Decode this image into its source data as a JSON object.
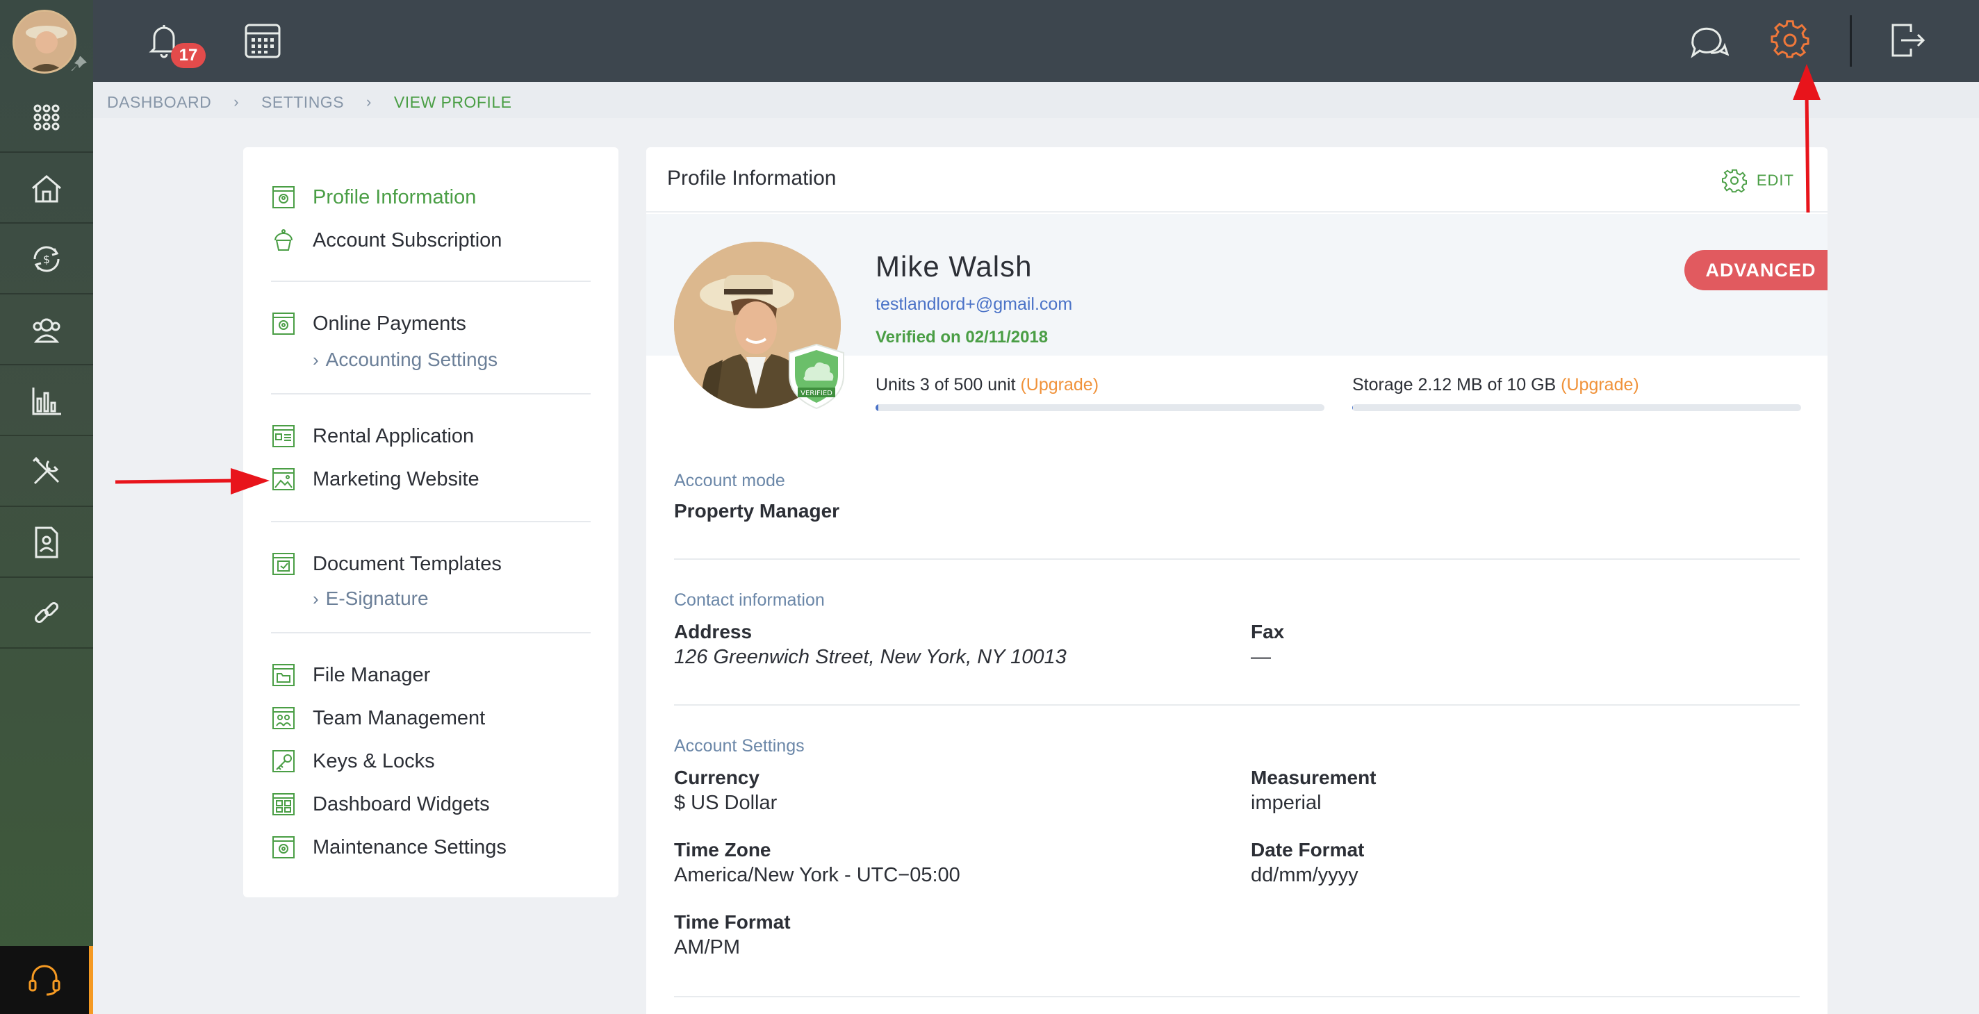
{
  "topbar": {
    "notification_count": "17"
  },
  "breadcrumb": {
    "items": [
      "DASHBOARD",
      "SETTINGS",
      "VIEW PROFILE"
    ]
  },
  "settings_menu": {
    "profile_information": "Profile Information",
    "account_subscription": "Account Subscription",
    "online_payments": "Online Payments",
    "accounting_settings": "Accounting Settings",
    "rental_application": "Rental Application",
    "marketing_website": "Marketing Website",
    "document_templates": "Document Templates",
    "e_signature": "E-Signature",
    "file_manager": "File Manager",
    "team_management": "Team Management",
    "keys_locks": "Keys & Locks",
    "dashboard_widgets": "Dashboard Widgets",
    "maintenance_settings": "Maintenance Settings"
  },
  "profile": {
    "card_title": "Profile Information",
    "edit_label": "EDIT",
    "name": "Mike Walsh",
    "email": "testlandlord+@gmail.com",
    "verified_text": "Verified on 02/11/2018",
    "verified_badge_text": "VERIFIED",
    "plan_badge": "ADVANCED",
    "units_text": "Units 3 of 500 unit ",
    "units_upgrade": "(Upgrade)",
    "units_fraction": 0.006,
    "storage_text": "Storage 2.12 MB of 10 GB ",
    "storage_upgrade": "(Upgrade)",
    "storage_fraction": 0.0002
  },
  "account_mode": {
    "section_label": "Account mode",
    "value": "Property Manager"
  },
  "contact": {
    "section_label": "Contact information",
    "address_label": "Address",
    "address_value": "126 Greenwich Street, New York, NY 10013",
    "fax_label": "Fax",
    "fax_value": "—"
  },
  "account_settings": {
    "section_label": "Account Settings",
    "currency_label": "Currency",
    "currency_value": "$ US Dollar",
    "measurement_label": "Measurement",
    "measurement_value": "imperial",
    "timezone_label": "Time Zone",
    "timezone_value": "America/New York - UTC−05:00",
    "date_format_label": "Date Format",
    "date_format_value": "dd/mm/yyyy",
    "time_format_label": "Time Format",
    "time_format_value": "AM/PM"
  },
  "colors": {
    "accent_green": "#4a9e45",
    "badge_red": "#e15a5f",
    "upgrade_orange": "#f0923a",
    "settings_icon_orange": "#f0783a",
    "annotation_red": "#e8141b"
  }
}
